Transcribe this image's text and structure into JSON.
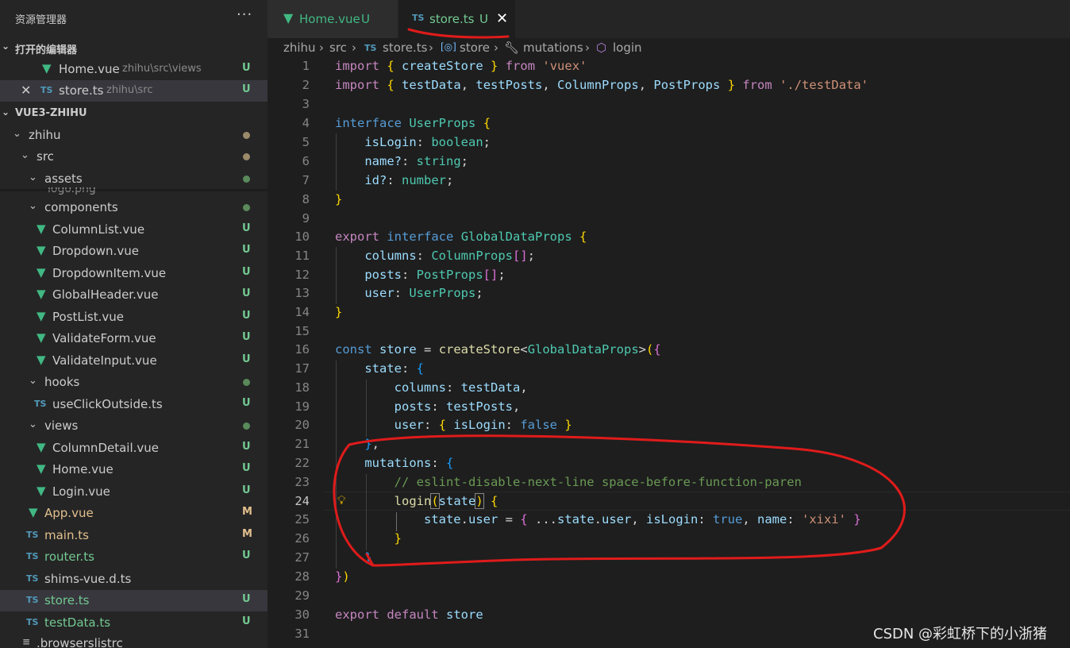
{
  "sidebar": {
    "title": "资源管理器",
    "more": "···",
    "open_editors": {
      "label": "打开的编辑器",
      "items": [
        {
          "name": "Home.vue",
          "path": "zhihu\\src\\views",
          "badge": "U"
        },
        {
          "name": "store.ts",
          "path": "zhihu\\src",
          "badge": "U"
        }
      ]
    },
    "workspace": {
      "label": "VUE3-ZHIHU",
      "folders": {
        "zhihu": "zhihu",
        "src": "src",
        "assets": "assets",
        "assets_partial": "logo.png",
        "components": "components",
        "hooks": "hooks",
        "views": "views"
      },
      "components": [
        {
          "name": "ColumnList.vue",
          "badge": "U"
        },
        {
          "name": "Dropdown.vue",
          "badge": "U"
        },
        {
          "name": "DropdownItem.vue",
          "badge": "U"
        },
        {
          "name": "GlobalHeader.vue",
          "badge": "U"
        },
        {
          "name": "PostList.vue",
          "badge": "U"
        },
        {
          "name": "ValidateForm.vue",
          "badge": "U"
        },
        {
          "name": "ValidateInput.vue",
          "badge": "U"
        }
      ],
      "hooks": [
        {
          "name": "useClickOutside.ts",
          "badge": "U"
        }
      ],
      "views": [
        {
          "name": "ColumnDetail.vue",
          "badge": "U"
        },
        {
          "name": "Home.vue",
          "badge": "U"
        },
        {
          "name": "Login.vue",
          "badge": "U"
        }
      ],
      "src_files": [
        {
          "name": "App.vue",
          "badge": "M"
        },
        {
          "name": "main.ts",
          "badge": "M"
        },
        {
          "name": "router.ts",
          "badge": "U"
        },
        {
          "name": "shims-vue.d.ts",
          "badge": ""
        },
        {
          "name": "store.ts",
          "badge": "U"
        },
        {
          "name": "testData.ts",
          "badge": "U"
        }
      ],
      "root_partial": ".browserslistrc"
    }
  },
  "tabs": [
    {
      "name": "Home.vue",
      "badge": "U"
    },
    {
      "name": "store.ts",
      "badge": "U",
      "close": "✕"
    }
  ],
  "breadcrumb": [
    "zhihu",
    "src",
    "store.ts",
    "store",
    "mutations",
    "login"
  ],
  "icons": {
    "ts": "TS",
    "vue": "▼",
    "close": "✕",
    "chevron_down": "⌄",
    "chevron_right": "›"
  },
  "code": {
    "current_line": 24,
    "line_numbers": [
      "1",
      "2",
      "3",
      "4",
      "5",
      "6",
      "7",
      "8",
      "9",
      "10",
      "11",
      "12",
      "13",
      "14",
      "15",
      "16",
      "17",
      "18",
      "19",
      "20",
      "21",
      "22",
      "23",
      "24",
      "25",
      "26",
      "27",
      "28",
      "29",
      "30",
      "31"
    ],
    "tokens": {
      "import": "import",
      "createStore": "createStore",
      "from": "from",
      "vuex": "'vuex'",
      "testData": "testData",
      "testPosts": "testPosts",
      "ColumnProps": "ColumnProps",
      "PostProps": "PostProps",
      "testDataPath": "'./testData'",
      "interface": "interface",
      "UserProps": "UserProps",
      "isLogin": "isLogin",
      "boolean": "boolean",
      "name_opt": "name?",
      "string": "string",
      "id_opt": "id?",
      "number": "number",
      "export": "export",
      "GlobalDataProps": "GlobalDataProps",
      "columns": "columns",
      "posts": "posts",
      "user": "user",
      "const": "const",
      "store": "store",
      "state": "state",
      "false": "false",
      "mutations": "mutations",
      "comment": "// eslint-disable-next-line space-before-function-paren",
      "login": "login",
      "true": "true",
      "name": "name",
      "xixi": "'xixi'",
      "default": "default"
    }
  },
  "watermark": "CSDN @彩虹桥下的小浙猪",
  "colors": {
    "annotation": "#e01b1b",
    "vue": "#41b883",
    "ts": "#519aba"
  }
}
